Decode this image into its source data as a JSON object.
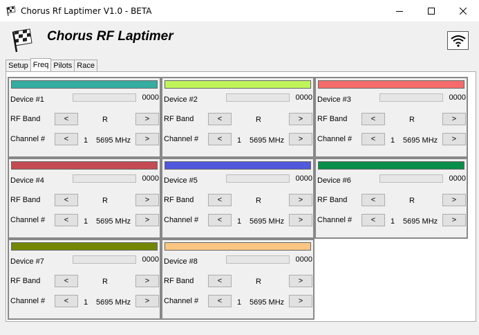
{
  "window": {
    "title": "Chorus Rf Laptimer V1.0 - BETA"
  },
  "header": {
    "title": "Chorus RF Laptimer"
  },
  "tabs": [
    {
      "label": "Setup"
    },
    {
      "label": "Freq",
      "active": true
    },
    {
      "label": "Pilots"
    },
    {
      "label": "Race"
    }
  ],
  "labels": {
    "rf_band": "RF Band",
    "channel": "Channel #",
    "prev": "<",
    "next": ">"
  },
  "devices": [
    {
      "name": "Device #1",
      "count": "0000",
      "band": "R",
      "channel": "1",
      "freq": "5695 MHz",
      "color": "#35ada1"
    },
    {
      "name": "Device #2",
      "count": "0000",
      "band": "R",
      "channel": "1",
      "freq": "5695 MHz",
      "color": "#c0f55a"
    },
    {
      "name": "Device #3",
      "count": "0000",
      "band": "R",
      "channel": "1",
      "freq": "5695 MHz",
      "color": "#f56b6b"
    },
    {
      "name": "Device #4",
      "count": "0000",
      "band": "R",
      "channel": "1",
      "freq": "5695 MHz",
      "color": "#c44b52"
    },
    {
      "name": "Device #5",
      "count": "0000",
      "band": "R",
      "channel": "1",
      "freq": "5695 MHz",
      "color": "#5058dc"
    },
    {
      "name": "Device #6",
      "count": "0000",
      "band": "R",
      "channel": "1",
      "freq": "5695 MHz",
      "color": "#0a8f4a"
    },
    {
      "name": "Device #7",
      "count": "0000",
      "band": "R",
      "channel": "1",
      "freq": "5695 MHz",
      "color": "#748705"
    },
    {
      "name": "Device #8",
      "count": "0000",
      "band": "R",
      "channel": "1",
      "freq": "5695 MHz",
      "color": "#fbc683"
    }
  ]
}
